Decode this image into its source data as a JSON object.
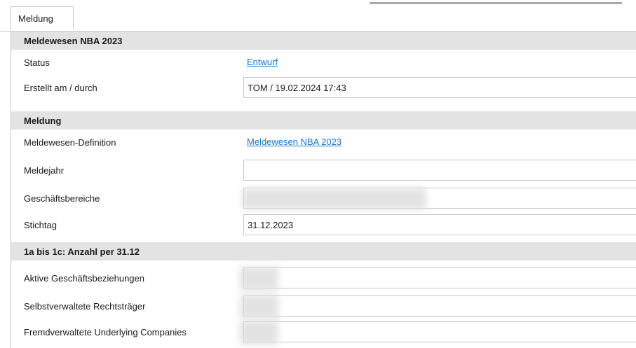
{
  "tabs": [
    {
      "label": "Meldung"
    }
  ],
  "sections": {
    "header": "Meldewesen NBA 2023",
    "meldung": "Meldung",
    "anzahl": "1a bis 1c: Anzahl per 31.12"
  },
  "fields": {
    "status": {
      "label": "Status",
      "value": "Entwurf"
    },
    "erstellt": {
      "label": "Erstellt am / durch",
      "value": "TOM / 19.02.2024 17:43"
    },
    "definition": {
      "label": "Meldewesen-Definition",
      "value": "Meldewesen NBA 2023"
    },
    "meldejahr": {
      "label": "Meldejahr",
      "value": ""
    },
    "geschaeftsbereiche": {
      "label": "Geschäftsbereiche",
      "value": ""
    },
    "stichtag": {
      "label": "Stichtag",
      "value": "31.12.2023"
    },
    "aktive": {
      "label": "Aktive Geschäftsbeziehungen",
      "value": ""
    },
    "selbstverwaltete": {
      "label": "Selbstverwaltete Rechtsträger",
      "value": ""
    },
    "fremdverwaltete": {
      "label": "Fremdverwaltete Underlying Companies",
      "value": ""
    }
  },
  "colors": {
    "link": "#1a75c9",
    "section_bg": "#e3e3e3",
    "border": "#c8c8c8"
  }
}
